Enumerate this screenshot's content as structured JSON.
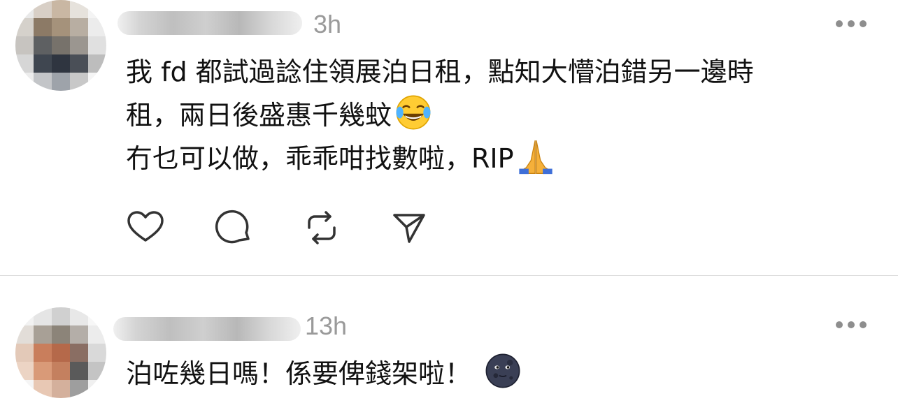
{
  "posts": [
    {
      "time": "3h",
      "lines": [
        "我 fd 都試過諗住領展泊日租，點知大懵泊錯另一邊時",
        "租，兩日後盛惠千幾蚊",
        "冇乜可以做，乖乖咁找數啦，RIP"
      ],
      "emojis": [
        "face-with-tears-of-joy",
        "folded-hands"
      ],
      "actions": [
        "like",
        "reply",
        "repost",
        "share"
      ]
    },
    {
      "time": "13h",
      "lines": [
        "泊咗幾日嗎！係要俾錢架啦！"
      ],
      "emojis": [
        "new-moon-face"
      ]
    }
  ],
  "colors": {
    "secondary_text": "#9a9a9a",
    "divider": "#dcdcdc",
    "icon": "#333333"
  }
}
